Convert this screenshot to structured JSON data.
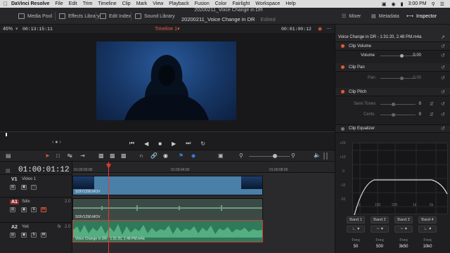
{
  "menubar": {
    "app_name": "DaVinci Resolve",
    "items": [
      "File",
      "Edit",
      "Trim",
      "Timeline",
      "Clip",
      "Mark",
      "View",
      "Playback",
      "Fusion",
      "Color",
      "Fairlight",
      "Workspace",
      "Help"
    ],
    "clock": "3:00 PM"
  },
  "toolbar": {
    "media_pool": "Media Pool",
    "effects_library": "Effects Library",
    "edit_index": "Edit Index",
    "sound_library": "Sound Library",
    "window_title": "20200211_Voice Change in DR",
    "project_name": "20200211_Voice Change in DR",
    "edited": "Edited",
    "mixer": "Mixer",
    "metadata": "Metadata",
    "inspector": "Inspector"
  },
  "viewer": {
    "zoom": "46%",
    "timecode_left": "00:13:15:11",
    "timeline_name": "Timeline 1",
    "timecode_right": "00:01:00:12"
  },
  "timeline": {
    "current_timecode": "01:00:01:12",
    "ruler_ticks": [
      "01:00:00:00",
      "01:00:04:00",
      "01:00:08:00"
    ],
    "tracks": [
      {
        "id": "V1",
        "label": "Video 1",
        "num": ""
      },
      {
        "id": "A1",
        "label": "Sdiv",
        "num": "2.0"
      },
      {
        "id": "A2",
        "label": "Yeti",
        "num": "2.0",
        "fx": "fx"
      }
    ],
    "clips": {
      "video": "SDIV1290.MOV",
      "audio1": "SDIV1290.MOV",
      "audio2": "Voice Change in DR - 1:31:20, 2.48 PM.m4a"
    }
  },
  "inspector": {
    "title": "Voice Change in DR - 1:31:20, 2.48 PM.m4a",
    "clip_volume": {
      "header": "Clip Volume",
      "label": "Volume",
      "value": "0.00"
    },
    "clip_pan": {
      "header": "Clip Pan",
      "label": "Pan",
      "value": "0.00"
    },
    "clip_pitch": {
      "header": "Clip Pitch",
      "semi_label": "Semi Tones",
      "semi_value": "0",
      "cents_label": "Cents",
      "cents_value": "0"
    },
    "clip_equalizer": {
      "header": "Clip Equalizer",
      "y_ticks": [
        "+20",
        "+10",
        "0",
        "-10",
        "-20"
      ],
      "x_ticks": [
        "30",
        "100",
        "200",
        "1k",
        "5k",
        "10k"
      ],
      "bands": [
        {
          "label": "Band 1",
          "freq_label": "Freq",
          "freq": "50"
        },
        {
          "label": "Band 2",
          "freq_label": "Freq",
          "freq": "500"
        },
        {
          "label": "Band 3",
          "freq_label": "Freq",
          "freq": "3k50"
        },
        {
          "label": "Band 4",
          "freq_label": "Freq",
          "freq": "10k0"
        }
      ]
    }
  }
}
